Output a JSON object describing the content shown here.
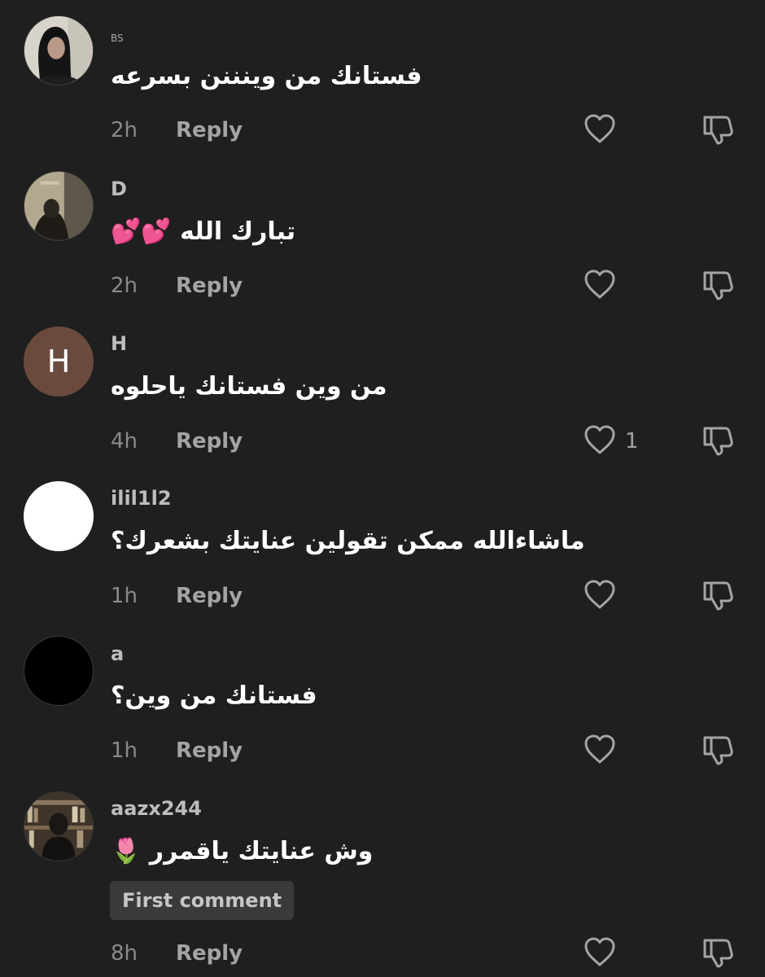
{
  "comments": [
    {
      "username": "BS",
      "text": "فستانك من وينننن بسرعه",
      "time": "2h",
      "reply_label": "Reply",
      "like_count": "",
      "avatar": {
        "type": "photo",
        "colors": [
          "#d8d4cc",
          "#1a1a1a"
        ]
      }
    },
    {
      "username": "D",
      "text": "تبارك الله 💕💕",
      "time": "2h",
      "reply_label": "Reply",
      "like_count": "",
      "avatar": {
        "type": "photo",
        "colors": [
          "#8a8270",
          "#2a2620"
        ]
      }
    },
    {
      "username": "H",
      "text": "من وين فستانك ياحلوه",
      "time": "4h",
      "reply_label": "Reply",
      "like_count": "1",
      "avatar": {
        "type": "letter",
        "letter": "H",
        "bg": "#6b4a3e"
      }
    },
    {
      "username": "ilil1l2",
      "text": "ماشاءالله ممكن تقولين عنايتك بشعرك؟",
      "time": "1h",
      "reply_label": "Reply",
      "like_count": "",
      "avatar": {
        "type": "solid",
        "bg": "#ffffff"
      }
    },
    {
      "username": "a",
      "text": "فستانك من وين؟",
      "time": "1h",
      "reply_label": "Reply",
      "like_count": "",
      "avatar": {
        "type": "solid",
        "bg": "#000000"
      }
    },
    {
      "username": "aazx244",
      "text": "وش  عنايتك ياقمرر  🌷",
      "badge": "First comment",
      "time": "8h",
      "reply_label": "Reply",
      "like_count": "",
      "avatar": {
        "type": "photo",
        "colors": [
          "#6a5a48",
          "#1c1814"
        ]
      }
    }
  ],
  "icons": {
    "like": "heart-outline-icon",
    "dislike": "thumbs-down-outline-icon"
  },
  "colors": {
    "background": "#1f1f1f",
    "text": "#ffffff",
    "username": "#bdbdbd",
    "meta": "#8a8a8a",
    "badge_bg": "#3a3a3a"
  }
}
